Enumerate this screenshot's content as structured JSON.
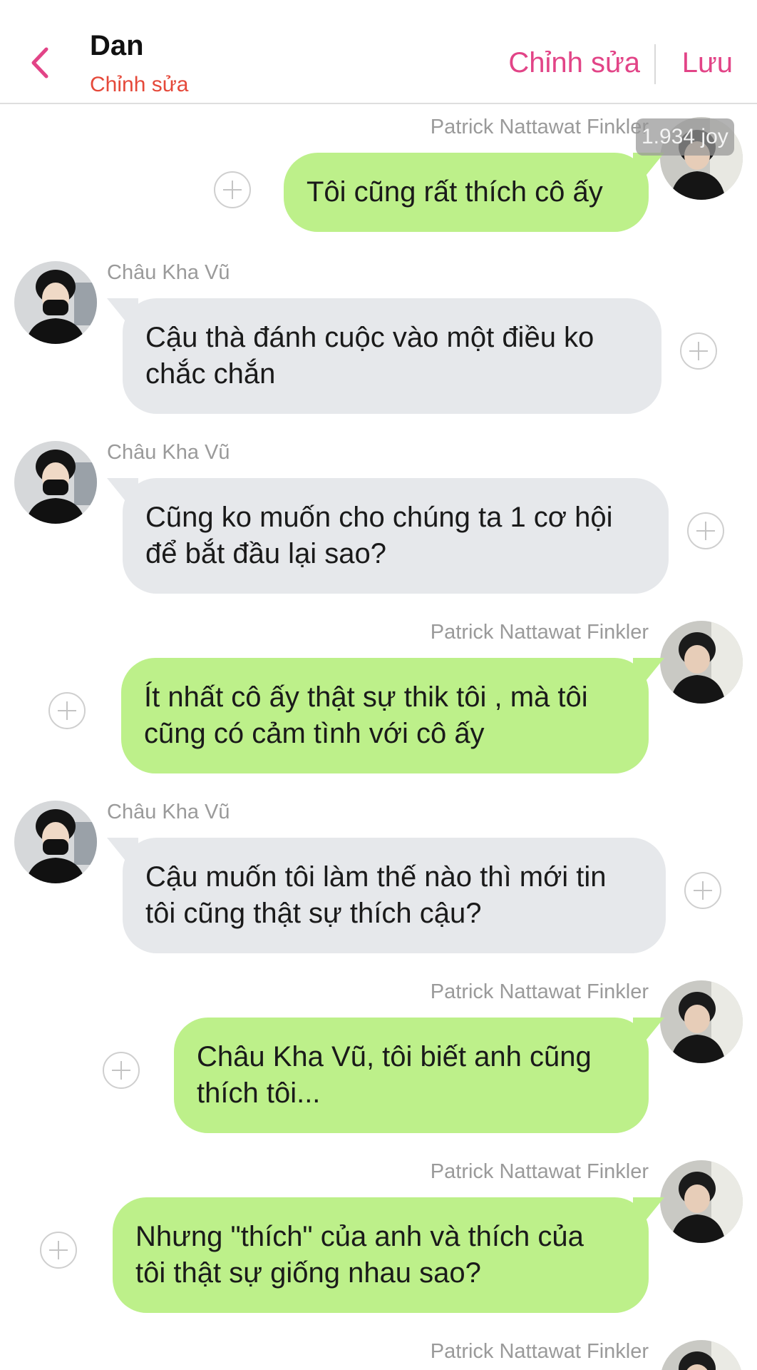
{
  "header": {
    "title": "Dan",
    "subtitle": "Chỉnh sửa",
    "edit_label": "Chỉnh sửa",
    "save_label": "Lưu",
    "accent_color": "#e24487"
  },
  "badge": {
    "text": "1.934 joy"
  },
  "messages": [
    {
      "side": "right",
      "sender": "Patrick Nattawat Finkler",
      "lines": [
        "Tôi cũng rất thích cô ấy"
      ]
    },
    {
      "side": "left",
      "sender": "Châu Kha Vũ",
      "lines": [
        "Cậu thà đánh cuộc vào một điều ko",
        "chắc chắn"
      ]
    },
    {
      "side": "left",
      "sender": "Châu Kha Vũ",
      "lines": [
        "Cũng ko muốn cho chúng ta 1 cơ hội",
        "để bắt đầu lại sao?"
      ]
    },
    {
      "side": "right",
      "sender": "Patrick Nattawat Finkler",
      "lines": [
        "Ít nhất cô ấy thật sự thik tôi , mà tôi",
        "cũng có cảm tình với cô ấy"
      ]
    },
    {
      "side": "left",
      "sender": "Châu Kha Vũ",
      "lines": [
        "Cậu muốn tôi làm thế nào thì mới tin",
        "tôi cũng thật sự thích cậu?"
      ]
    },
    {
      "side": "right",
      "sender": "Patrick Nattawat Finkler",
      "lines": [
        "Châu Kha Vũ, tôi biết anh cũng",
        "thích tôi..."
      ]
    },
    {
      "side": "right",
      "sender": "Patrick Nattawat Finkler",
      "lines": [
        "Nhưng \"thích\" của anh và thích của",
        "tôi thật sự giống nhau sao?"
      ]
    },
    {
      "side": "right",
      "sender": "Patrick Nattawat Finkler",
      "lines": []
    }
  ]
}
